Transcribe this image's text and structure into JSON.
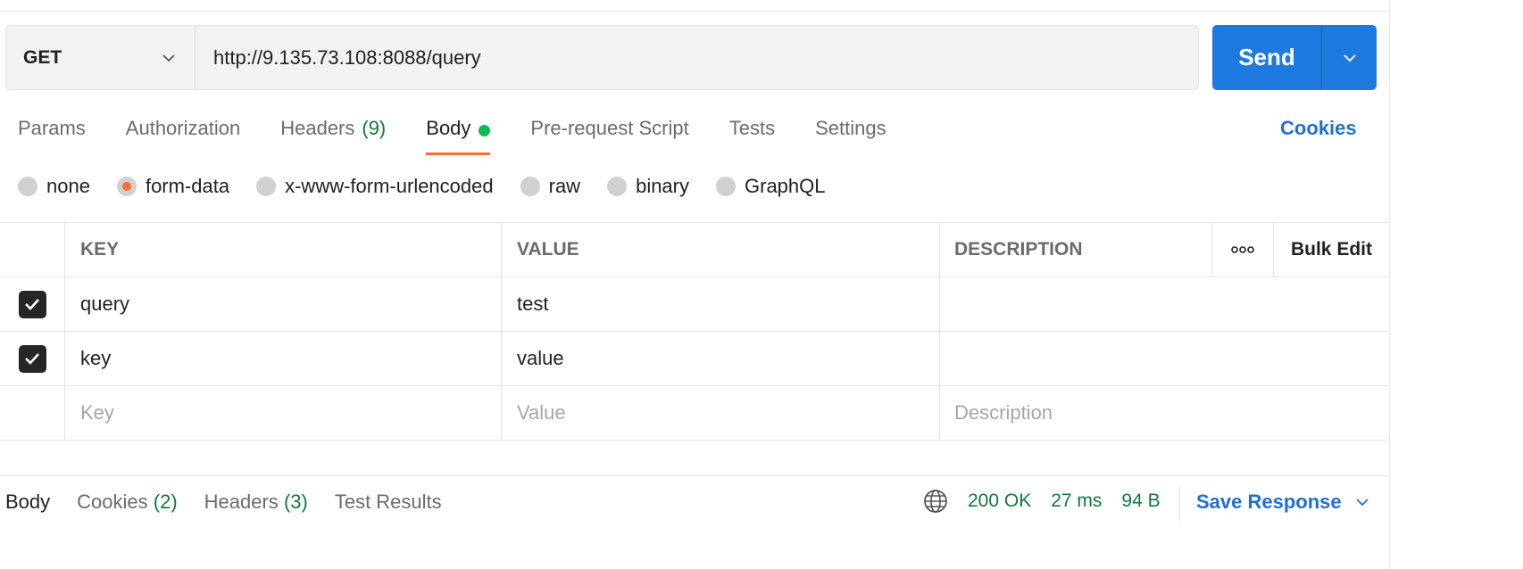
{
  "request": {
    "method": "GET",
    "url": "http://9.135.73.108:8088/query",
    "send_label": "Send"
  },
  "tabs": [
    {
      "label": "Params"
    },
    {
      "label": "Authorization"
    },
    {
      "label": "Headers",
      "count": "(9)"
    },
    {
      "label": "Body",
      "active": true,
      "has_dot": true
    },
    {
      "label": "Pre-request Script"
    },
    {
      "label": "Tests"
    },
    {
      "label": "Settings"
    }
  ],
  "cookies_link": "Cookies",
  "body_types": [
    {
      "label": "none"
    },
    {
      "label": "form-data",
      "selected": true
    },
    {
      "label": "x-www-form-urlencoded"
    },
    {
      "label": "raw"
    },
    {
      "label": "binary"
    },
    {
      "label": "GraphQL"
    }
  ],
  "table": {
    "headers": {
      "key": "KEY",
      "value": "VALUE",
      "description": "DESCRIPTION",
      "bulk_edit": "Bulk Edit"
    },
    "rows": [
      {
        "checked": true,
        "key": "query",
        "value": "test",
        "description": ""
      },
      {
        "checked": true,
        "key": "key",
        "value": "value",
        "description": ""
      }
    ],
    "placeholders": {
      "key": "Key",
      "value": "Value",
      "description": "Description"
    }
  },
  "response": {
    "tabs": [
      {
        "label": "Body",
        "active": true
      },
      {
        "label": "Cookies",
        "count": "(2)"
      },
      {
        "label": "Headers",
        "count": "(3)"
      },
      {
        "label": "Test Results"
      }
    ],
    "status": "200 OK",
    "time": "27 ms",
    "size": "94 B",
    "save_label": "Save Response"
  },
  "colors": {
    "accent": "#ff6c37",
    "primary": "#1f7ae0",
    "success": "#0f7a38"
  }
}
